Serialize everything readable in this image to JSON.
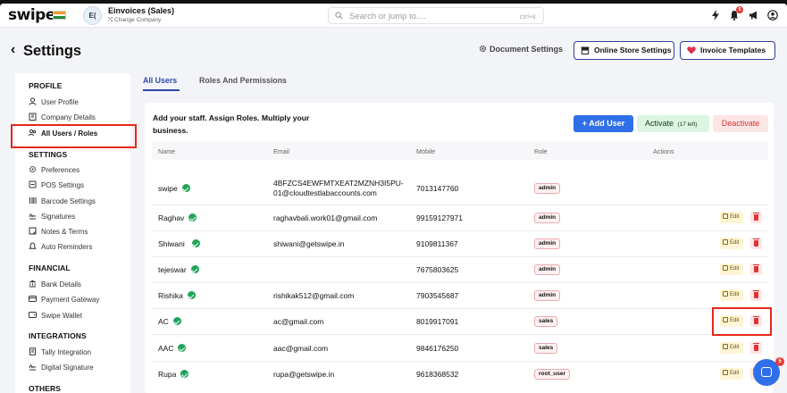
{
  "topbar": {
    "logo": "swipe",
    "company_initials": "E(",
    "company_name": "Einvoices (Sales)",
    "change_company": "⤭ Change Company",
    "search_placeholder": "Search or jump to....",
    "search_shortcut": "ctrl+k",
    "notification_count": "5"
  },
  "header": {
    "back": "‹",
    "title": "Settings",
    "document_settings": "Document Settings",
    "online_store_settings": "Online Store Settings",
    "invoice_templates": "Invoice Templates"
  },
  "sidebar": {
    "sections": [
      {
        "title": "PROFILE",
        "items": [
          "User Profile",
          "Company Details",
          "All Users / Roles"
        ]
      },
      {
        "title": "SETTINGS",
        "items": [
          "Preferences",
          "POS Settings",
          "Barcode Settings",
          "Signatures",
          "Notes & Terms",
          "Auto Reminders"
        ]
      },
      {
        "title": "FINANCIAL",
        "items": [
          "Bank Details",
          "Payment Gateway",
          "Swipe Wallet"
        ]
      },
      {
        "title": "INTEGRATIONS",
        "items": [
          "Tally Integration",
          "Digital Signature"
        ]
      },
      {
        "title": "OTHERS",
        "items": []
      }
    ],
    "active_item": "All Users / Roles"
  },
  "tabs": [
    "All Users",
    "Roles And Permissions"
  ],
  "main": {
    "intro": "Add your staff. Assign Roles. Multiply your business.",
    "add_user": "+ Add User",
    "activate": "Activate",
    "activate_left": "(17 left)",
    "deactivate": "Deactivate",
    "columns": [
      "Name",
      "Email",
      "Mobile",
      "Role",
      "Actions"
    ],
    "edit_label": "Edit",
    "rows": [
      {
        "name": "swipe",
        "email": "4BFZCS4EWFMTXEAT2MZNH3I5PU-01@cloudtestlabaccounts.com",
        "email_line1": "4BFZCS4EWFMTXEAT2MZNH3I5PU-",
        "email_line2": "01@cloudtestlabaccounts.com",
        "mobile": "7013147760",
        "role": "admin",
        "actions": false
      },
      {
        "name": "Raghav",
        "email": "raghavbali.work01@gmail.com",
        "mobile": "9915912797​1",
        "role": "admin",
        "actions": true
      },
      {
        "name": "Shiwani",
        "email": "shiwani@getswipe.in",
        "mobile": "9109811367",
        "role": "admin",
        "actions": true
      },
      {
        "name": "tejeswar",
        "email": "",
        "mobile": "7675803625",
        "role": "admin",
        "actions": true
      },
      {
        "name": "Rishika",
        "email": "rishikak512@gmail.com",
        "mobile": "7903545687",
        "role": "admin",
        "actions": true
      },
      {
        "name": "AC",
        "email": "ac@gmail.com",
        "mobile": "8019917091",
        "role": "sales",
        "actions": true
      },
      {
        "name": "AAC",
        "email": "aac@gmail.com",
        "mobile": "9846176250",
        "role": "sales",
        "actions": true
      },
      {
        "name": "Rupa",
        "email": "rupa@getswipe.in",
        "mobile": "9618368532",
        "role": "root_user",
        "actions": true
      }
    ]
  },
  "chat_badge": "5",
  "colors": {
    "accent": "#2f6fe8",
    "tab_active": "#2d4aa8",
    "highlight": "#e5281b",
    "success": "#21a35a"
  }
}
